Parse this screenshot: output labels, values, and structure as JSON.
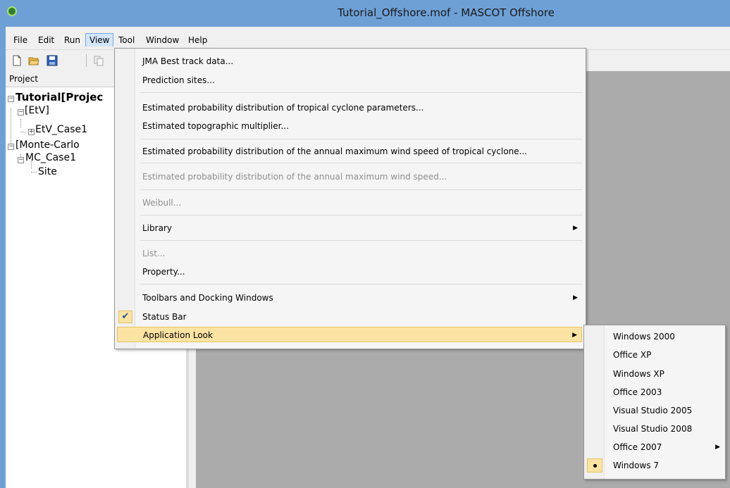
{
  "window": {
    "title": "Tutorial_Offshore.mof - MASCOT Offshore",
    "icon": "mascot-app-icon"
  },
  "menubar": {
    "items": [
      {
        "label": "File"
      },
      {
        "label": "Edit"
      },
      {
        "label": "Run"
      },
      {
        "label": "View",
        "active": true
      },
      {
        "label": "Tool"
      },
      {
        "label": "Window"
      },
      {
        "label": "Help"
      }
    ]
  },
  "toolbar": {
    "buttons": [
      "new-file-icon",
      "open-folder-icon",
      "save-icon",
      "copy-icon"
    ]
  },
  "project_pane": {
    "header": "Project",
    "tree": [
      {
        "label": "Tutorial[Projec",
        "level": 0,
        "expander": "-",
        "bold": true
      },
      {
        "label": "[EtV]",
        "level": 1,
        "expander": "-"
      },
      {
        "label": "EtV_Case1",
        "level": 2,
        "expander": "+"
      },
      {
        "label": "[Monte-Carlo",
        "level": 1,
        "expander": "-"
      },
      {
        "label": "MC_Case1",
        "level": 2,
        "expander": "-"
      },
      {
        "label": "Site",
        "level": 3,
        "expander": ""
      }
    ]
  },
  "view_menu": {
    "items": [
      {
        "label": "JMA Best track data...",
        "enabled": true
      },
      {
        "label": "Prediction sites...",
        "enabled": true
      },
      {
        "label": "Estimated probability distribution of tropical cyclone parameters...",
        "enabled": true
      },
      {
        "label": "Estimated topographic multiplier...",
        "enabled": true
      },
      {
        "label": "Estimated probability distribution of the annual maximum wind speed of tropical cyclone...",
        "enabled": true
      },
      {
        "label": "Estimated probability distribution of the annual maximum wind speed...",
        "enabled": false
      },
      {
        "label": "Weibull...",
        "enabled": false
      },
      {
        "label": "Library",
        "enabled": true,
        "submenu": true
      },
      {
        "label": "List...",
        "enabled": false
      },
      {
        "label": "Property...",
        "enabled": true
      },
      {
        "label": "Toolbars and Docking Windows",
        "enabled": true,
        "submenu": true
      },
      {
        "label": "Status Bar",
        "enabled": true,
        "checked": true
      },
      {
        "label": "Application Look",
        "enabled": true,
        "submenu": true,
        "highlighted": true
      }
    ]
  },
  "application_look_submenu": {
    "items": [
      {
        "label": "Windows 2000"
      },
      {
        "label": "Office XP"
      },
      {
        "label": "Windows XP"
      },
      {
        "label": "Office 2003"
      },
      {
        "label": "Visual Studio 2005"
      },
      {
        "label": "Visual Studio 2008"
      },
      {
        "label": "Office 2007",
        "submenu": true
      },
      {
        "label": "Windows 7",
        "selected": true
      }
    ]
  },
  "colors": {
    "title_bar": "#6ea0d6",
    "highlight": "#fbe3a4",
    "mdi_background": "#ababab"
  }
}
